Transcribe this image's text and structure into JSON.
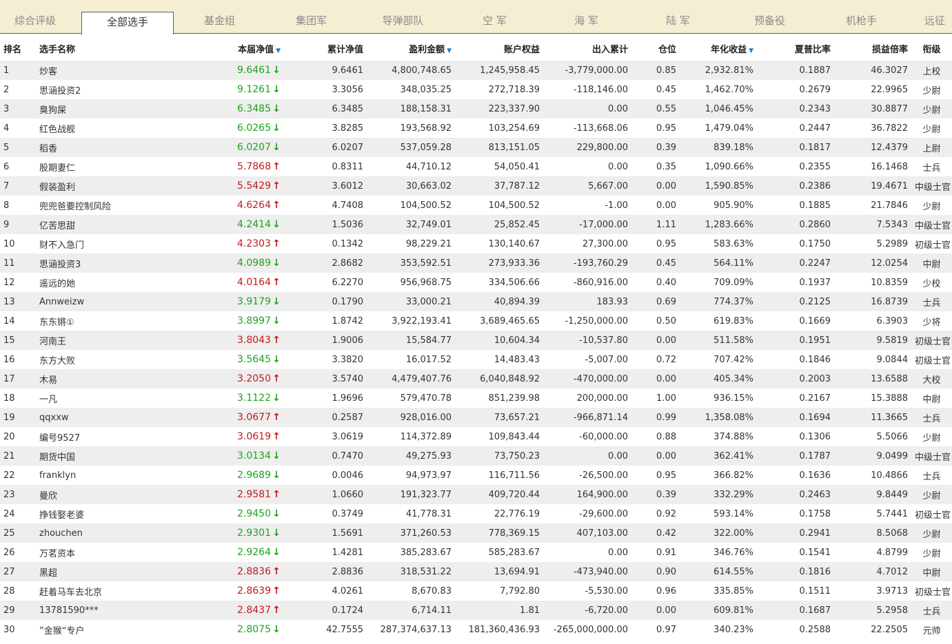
{
  "tabs": [
    {
      "label": "综合评级",
      "active": false
    },
    {
      "label": "全部选手",
      "active": true
    },
    {
      "label": "基金组",
      "active": false
    },
    {
      "label": "集团军",
      "active": false
    },
    {
      "label": "导弹部队",
      "active": false
    },
    {
      "label": "空  军",
      "active": false
    },
    {
      "label": "海  军",
      "active": false
    },
    {
      "label": "陆  军",
      "active": false
    },
    {
      "label": "预备役",
      "active": false
    },
    {
      "label": "机枪手",
      "active": false
    },
    {
      "label": "远征",
      "active": false
    }
  ],
  "colors": {
    "up": "#c01a1a",
    "down": "#1aa51a",
    "tabbar": "#f4efd3",
    "stripe": "#eeeeee",
    "sort_indicator": "#1a7fc1"
  },
  "columns": [
    "排名",
    "选手名称",
    "本届净值",
    "累计净值",
    "盈利金额",
    "账户权益",
    "出入累计",
    "仓位",
    "年化收益",
    "夏普比率",
    "损益倍率",
    "衔级"
  ],
  "sortable_columns": [
    "本届净值",
    "盈利金额",
    "年化收益"
  ],
  "rows": [
    {
      "rank": "1",
      "name": "炒客",
      "netval": "9.6461",
      "dir": "down",
      "cum": "9.6461",
      "profit": "4,800,748.65",
      "equity": "1,245,958.45",
      "flow": "-3,779,000.00",
      "pos": "0.85",
      "annual": "2,932.81%",
      "sharpe": "0.1887",
      "ratio": "46.3027",
      "grade": "上校"
    },
    {
      "rank": "2",
      "name": "思涵投资2",
      "netval": "9.1261",
      "dir": "down",
      "cum": "3.3056",
      "profit": "348,035.25",
      "equity": "272,718.39",
      "flow": "-118,146.00",
      "pos": "0.45",
      "annual": "1,462.70%",
      "sharpe": "0.2679",
      "ratio": "22.9965",
      "grade": "少尉"
    },
    {
      "rank": "3",
      "name": "臭狗屎",
      "netval": "6.3485",
      "dir": "down",
      "cum": "6.3485",
      "profit": "188,158.31",
      "equity": "223,337.90",
      "flow": "0.00",
      "pos": "0.55",
      "annual": "1,046.45%",
      "sharpe": "0.2343",
      "ratio": "30.8877",
      "grade": "少尉"
    },
    {
      "rank": "4",
      "name": "红色战舰",
      "netval": "6.0265",
      "dir": "down",
      "cum": "3.8285",
      "profit": "193,568.92",
      "equity": "103,254.69",
      "flow": "-113,668.06",
      "pos": "0.95",
      "annual": "1,479.04%",
      "sharpe": "0.2447",
      "ratio": "36.7822",
      "grade": "少尉"
    },
    {
      "rank": "5",
      "name": "稻香",
      "netval": "6.0207",
      "dir": "down",
      "cum": "6.0207",
      "profit": "537,059.28",
      "equity": "813,151.05",
      "flow": "229,800.00",
      "pos": "0.39",
      "annual": "839.18%",
      "sharpe": "0.1817",
      "ratio": "12.4379",
      "grade": "上尉"
    },
    {
      "rank": "6",
      "name": "股期妻仁",
      "netval": "5.7868",
      "dir": "up",
      "cum": "0.8311",
      "profit": "44,710.12",
      "equity": "54,050.41",
      "flow": "0.00",
      "pos": "0.35",
      "annual": "1,090.66%",
      "sharpe": "0.2355",
      "ratio": "16.1468",
      "grade": "士兵"
    },
    {
      "rank": "7",
      "name": "假装盈利",
      "netval": "5.5429",
      "dir": "up",
      "cum": "3.6012",
      "profit": "30,663.02",
      "equity": "37,787.12",
      "flow": "5,667.00",
      "pos": "0.00",
      "annual": "1,590.85%",
      "sharpe": "0.2386",
      "ratio": "19.4671",
      "grade": "中级士官"
    },
    {
      "rank": "8",
      "name": "兜兜爸要控制风险",
      "netval": "4.6264",
      "dir": "up",
      "cum": "4.7408",
      "profit": "104,500.52",
      "equity": "104,500.52",
      "flow": "-1.00",
      "pos": "0.00",
      "annual": "905.90%",
      "sharpe": "0.1885",
      "ratio": "21.7846",
      "grade": "少尉"
    },
    {
      "rank": "9",
      "name": "亿苦思甜",
      "netval": "4.2414",
      "dir": "down",
      "cum": "1.5036",
      "profit": "32,749.01",
      "equity": "25,852.45",
      "flow": "-17,000.00",
      "pos": "1.11",
      "annual": "1,283.66%",
      "sharpe": "0.2860",
      "ratio": "7.5343",
      "grade": "中级士官"
    },
    {
      "rank": "10",
      "name": "财不入急门",
      "netval": "4.2303",
      "dir": "up",
      "cum": "0.1342",
      "profit": "98,229.21",
      "equity": "130,140.67",
      "flow": "27,300.00",
      "pos": "0.95",
      "annual": "583.63%",
      "sharpe": "0.1750",
      "ratio": "5.2989",
      "grade": "初级士官"
    },
    {
      "rank": "11",
      "name": "思涵投资3",
      "netval": "4.0989",
      "dir": "down",
      "cum": "2.8682",
      "profit": "353,592.51",
      "equity": "273,933.36",
      "flow": "-193,760.29",
      "pos": "0.45",
      "annual": "564.11%",
      "sharpe": "0.2247",
      "ratio": "12.0254",
      "grade": "中尉"
    },
    {
      "rank": "12",
      "name": "遥远的她",
      "netval": "4.0164",
      "dir": "up",
      "cum": "6.2270",
      "profit": "956,968.75",
      "equity": "334,506.66",
      "flow": "-860,916.00",
      "pos": "0.40",
      "annual": "709.09%",
      "sharpe": "0.1937",
      "ratio": "10.8359",
      "grade": "少校"
    },
    {
      "rank": "13",
      "name": "Annweizw",
      "netval": "3.9179",
      "dir": "down",
      "cum": "0.1790",
      "profit": "33,000.21",
      "equity": "40,894.39",
      "flow": "183.93",
      "pos": "0.69",
      "annual": "774.37%",
      "sharpe": "0.2125",
      "ratio": "16.8739",
      "grade": "士兵"
    },
    {
      "rank": "14",
      "name": "东东锵①",
      "netval": "3.8997",
      "dir": "down",
      "cum": "1.8742",
      "profit": "3,922,193.41",
      "equity": "3,689,465.65",
      "flow": "-1,250,000.00",
      "pos": "0.50",
      "annual": "619.83%",
      "sharpe": "0.1669",
      "ratio": "6.3903",
      "grade": "少将"
    },
    {
      "rank": "15",
      "name": "河南王",
      "netval": "3.8043",
      "dir": "up",
      "cum": "1.9006",
      "profit": "15,584.77",
      "equity": "10,604.34",
      "flow": "-10,537.80",
      "pos": "0.00",
      "annual": "511.58%",
      "sharpe": "0.1951",
      "ratio": "9.5819",
      "grade": "初级士官"
    },
    {
      "rank": "16",
      "name": "东方大败",
      "netval": "3.5645",
      "dir": "down",
      "cum": "3.3820",
      "profit": "16,017.52",
      "equity": "14,483.43",
      "flow": "-5,007.00",
      "pos": "0.72",
      "annual": "707.42%",
      "sharpe": "0.1846",
      "ratio": "9.0844",
      "grade": "初级士官"
    },
    {
      "rank": "17",
      "name": "木易",
      "netval": "3.2050",
      "dir": "up",
      "cum": "3.5740",
      "profit": "4,479,407.76",
      "equity": "6,040,848.92",
      "flow": "-470,000.00",
      "pos": "0.00",
      "annual": "405.34%",
      "sharpe": "0.2003",
      "ratio": "13.6588",
      "grade": "大校"
    },
    {
      "rank": "18",
      "name": "一凡",
      "netval": "3.1122",
      "dir": "down",
      "cum": "1.9696",
      "profit": "579,470.78",
      "equity": "851,239.98",
      "flow": "200,000.00",
      "pos": "1.00",
      "annual": "936.15%",
      "sharpe": "0.2167",
      "ratio": "15.3888",
      "grade": "中尉"
    },
    {
      "rank": "19",
      "name": "qqxxw",
      "netval": "3.0677",
      "dir": "up",
      "cum": "0.2587",
      "profit": "928,016.00",
      "equity": "73,657.21",
      "flow": "-966,871.14",
      "pos": "0.99",
      "annual": "1,358.08%",
      "sharpe": "0.1694",
      "ratio": "11.3665",
      "grade": "士兵"
    },
    {
      "rank": "20",
      "name": "编号9527",
      "netval": "3.0619",
      "dir": "up",
      "cum": "3.0619",
      "profit": "114,372.89",
      "equity": "109,843.44",
      "flow": "-60,000.00",
      "pos": "0.88",
      "annual": "374.88%",
      "sharpe": "0.1306",
      "ratio": "5.5066",
      "grade": "少尉"
    },
    {
      "rank": "21",
      "name": "期货中国",
      "netval": "3.0134",
      "dir": "down",
      "cum": "0.7470",
      "profit": "49,275.93",
      "equity": "73,750.23",
      "flow": "0.00",
      "pos": "0.00",
      "annual": "362.41%",
      "sharpe": "0.1787",
      "ratio": "9.0499",
      "grade": "中级士官"
    },
    {
      "rank": "22",
      "name": "franklyn",
      "netval": "2.9689",
      "dir": "down",
      "cum": "0.0046",
      "profit": "94,973.97",
      "equity": "116,711.56",
      "flow": "-26,500.00",
      "pos": "0.95",
      "annual": "366.82%",
      "sharpe": "0.1636",
      "ratio": "10.4866",
      "grade": "士兵"
    },
    {
      "rank": "23",
      "name": "曼欣",
      "netval": "2.9581",
      "dir": "up",
      "cum": "1.0660",
      "profit": "191,323.77",
      "equity": "409,720.44",
      "flow": "164,900.00",
      "pos": "0.39",
      "annual": "332.29%",
      "sharpe": "0.2463",
      "ratio": "9.8449",
      "grade": "少尉"
    },
    {
      "rank": "24",
      "name": "挣钱娶老婆",
      "netval": "2.9450",
      "dir": "down",
      "cum": "0.3749",
      "profit": "41,778.31",
      "equity": "22,776.19",
      "flow": "-29,600.00",
      "pos": "0.92",
      "annual": "593.14%",
      "sharpe": "0.1758",
      "ratio": "5.7441",
      "grade": "初级士官"
    },
    {
      "rank": "25",
      "name": "zhouchen",
      "netval": "2.9301",
      "dir": "down",
      "cum": "1.5691",
      "profit": "371,260.53",
      "equity": "778,369.15",
      "flow": "407,103.00",
      "pos": "0.42",
      "annual": "322.00%",
      "sharpe": "0.2941",
      "ratio": "8.5068",
      "grade": "少尉"
    },
    {
      "rank": "26",
      "name": "万茗资本",
      "netval": "2.9264",
      "dir": "down",
      "cum": "1.4281",
      "profit": "385,283.67",
      "equity": "585,283.67",
      "flow": "0.00",
      "pos": "0.91",
      "annual": "346.76%",
      "sharpe": "0.1541",
      "ratio": "4.8799",
      "grade": "少尉"
    },
    {
      "rank": "27",
      "name": "黑超",
      "netval": "2.8836",
      "dir": "up",
      "cum": "2.8836",
      "profit": "318,531.22",
      "equity": "13,694.91",
      "flow": "-473,940.00",
      "pos": "0.90",
      "annual": "614.55%",
      "sharpe": "0.1816",
      "ratio": "4.7012",
      "grade": "中尉"
    },
    {
      "rank": "28",
      "name": "赶着马车去北京",
      "netval": "2.8639",
      "dir": "up",
      "cum": "4.0261",
      "profit": "8,670.83",
      "equity": "7,792.80",
      "flow": "-5,530.00",
      "pos": "0.96",
      "annual": "335.85%",
      "sharpe": "0.1511",
      "ratio": "3.9713",
      "grade": "初级士官"
    },
    {
      "rank": "29",
      "name": "13781590***",
      "netval": "2.8437",
      "dir": "up",
      "cum": "0.1724",
      "profit": "6,714.11",
      "equity": "1.81",
      "flow": "-6,720.00",
      "pos": "0.00",
      "annual": "609.81%",
      "sharpe": "0.1687",
      "ratio": "5.2958",
      "grade": "士兵"
    },
    {
      "rank": "30",
      "name": "”金猴“专户",
      "netval": "2.8075",
      "dir": "down",
      "cum": "42.7555",
      "profit": "287,374,637.13",
      "equity": "181,360,436.93",
      "flow": "-265,000,000.00",
      "pos": "0.97",
      "annual": "340.23%",
      "sharpe": "0.2588",
      "ratio": "22.2505",
      "grade": "元帅"
    }
  ]
}
